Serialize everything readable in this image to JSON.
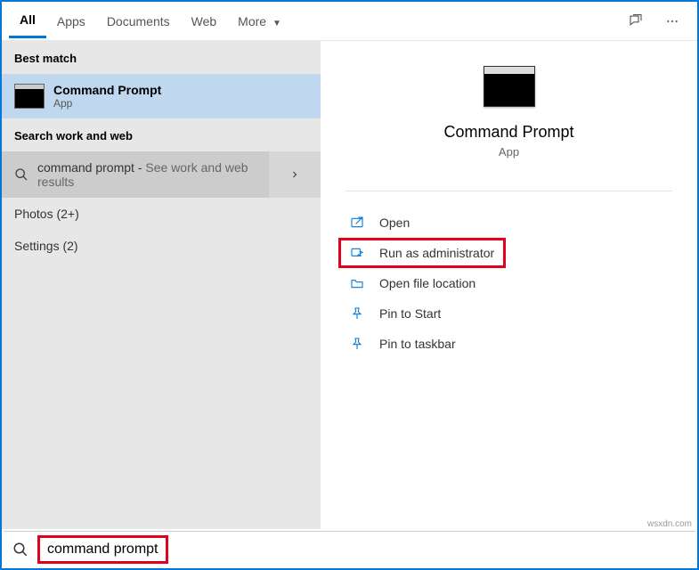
{
  "tabs": {
    "all": "All",
    "apps": "Apps",
    "documents": "Documents",
    "web": "Web",
    "more": "More"
  },
  "left": {
    "best_match_hdr": "Best match",
    "best_match": {
      "title": "Command Prompt",
      "sub": "App"
    },
    "work_web_hdr": "Search work and web",
    "web_item": {
      "title": "command prompt",
      "sub": "See work and web results"
    },
    "photos": "Photos (2+)",
    "settings": "Settings (2)"
  },
  "preview": {
    "title": "Command Prompt",
    "sub": "App"
  },
  "actions": {
    "open": "Open",
    "run_admin": "Run as administrator",
    "open_loc": "Open file location",
    "pin_start": "Pin to Start",
    "pin_taskbar": "Pin to taskbar"
  },
  "search": {
    "value": "command prompt"
  },
  "watermark": "wsxdn.com"
}
